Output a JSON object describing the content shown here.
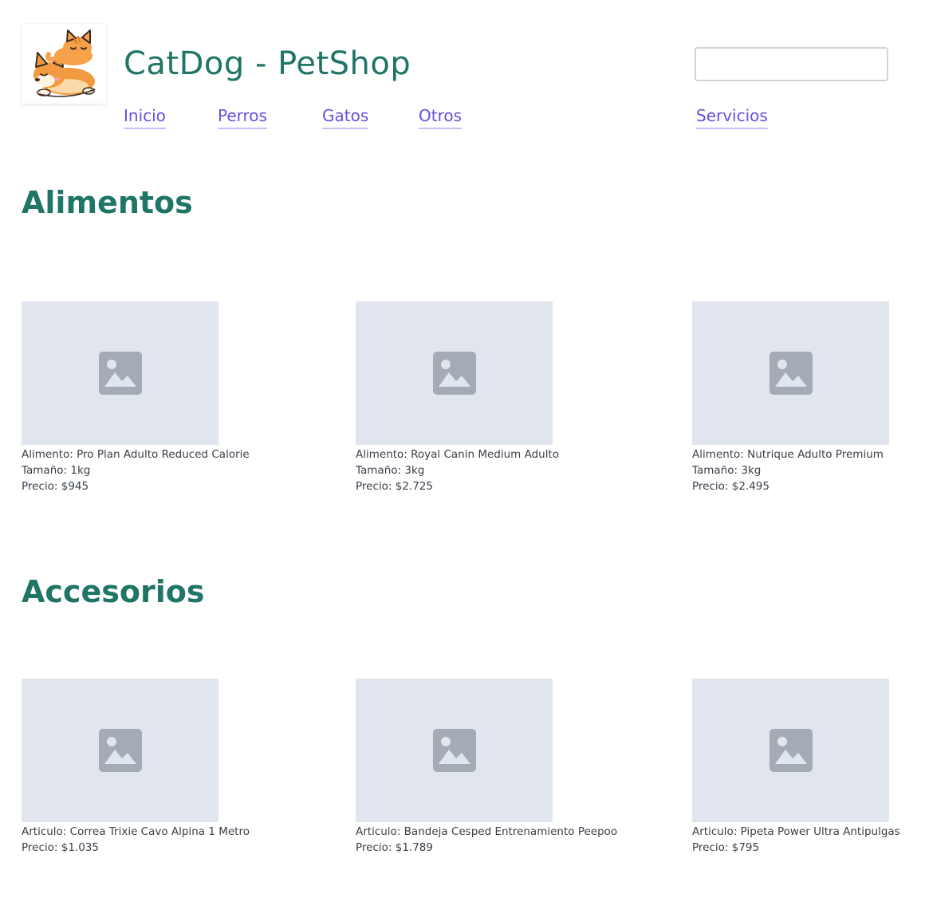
{
  "header": {
    "title": "CatDog - PetShop",
    "logo_icon": "cat-and-dog-sleeping-logo",
    "search": {
      "value": "",
      "placeholder": ""
    }
  },
  "nav": {
    "inicio": "Inicio",
    "perros": "Perros",
    "gatos": "Gatos",
    "otros": "Otros",
    "servicios": "Servicios"
  },
  "sections": [
    {
      "title": "Alimentos",
      "items": [
        {
          "name": "Alimento: Pro Plan Adulto Reduced Calorie",
          "size": "Tamaño: 1kg",
          "price": "Precio: $945"
        },
        {
          "name": "Alimento: Royal Canin Medium Adulto",
          "size": "Tamaño: 3kg",
          "price": "Precio: $2.725"
        },
        {
          "name": "Alimento: Nutrique Adulto Premium",
          "size": "Tamaño: 3kg",
          "price": "Precio: $2.495"
        }
      ]
    },
    {
      "title": "Accesorios",
      "items": [
        {
          "name": "Articulo: Correa Trixie Cavo Alpina 1 Metro",
          "price": "Precio: $1.035"
        },
        {
          "name": "Articulo: Bandeja Cesped Entrenamiento Peepoo",
          "price": "Precio: $1.789"
        },
        {
          "name": "Articulo: Pipeta Power Ultra Antipulgas",
          "price": "Precio: $795"
        }
      ]
    }
  ],
  "icons": {
    "placeholder": "image-placeholder-icon"
  },
  "colors": {
    "title": "#1f7566",
    "link": "#6b4fe0",
    "link_underline": "#c9bff5",
    "placeholder_bg": "#e0e5ee",
    "placeholder_icon": "#a3abb5"
  }
}
